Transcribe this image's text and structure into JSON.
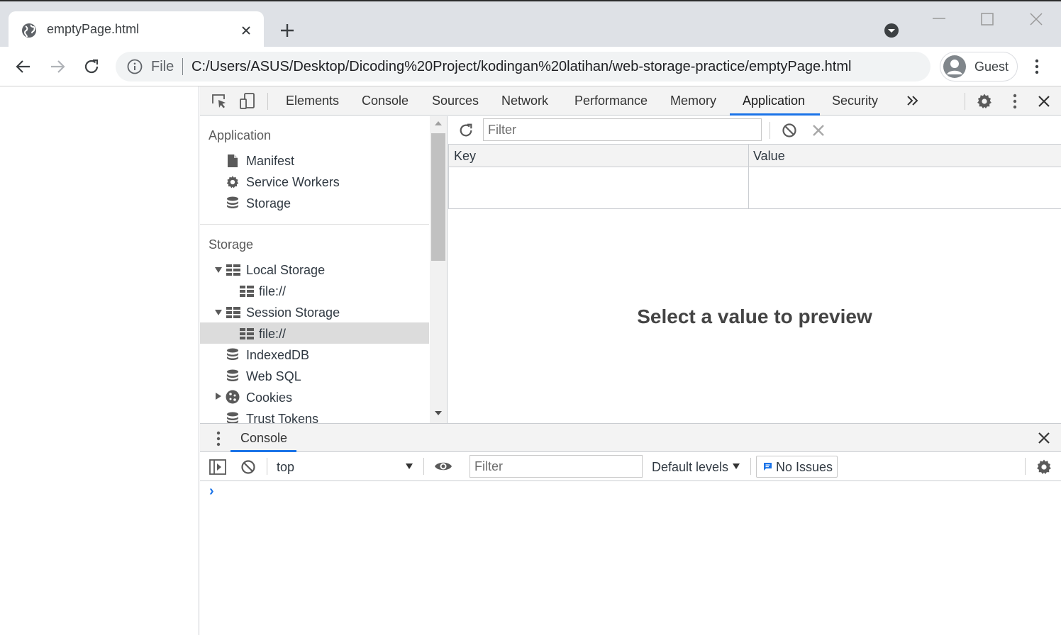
{
  "browser": {
    "tab_title": "emptyPage.html",
    "omnibox": {
      "scheme_label": "File",
      "url": "C:/Users/ASUS/Desktop/Dicoding%20Project/kodingan%20latihan/web-storage-practice/emptyPage.html"
    },
    "profile_label": "Guest"
  },
  "devtools": {
    "tabs": [
      "Elements",
      "Console",
      "Sources",
      "Network",
      "Performance",
      "Memory",
      "Application",
      "Security"
    ],
    "active_tab": "Application",
    "sidebar": {
      "application_section": {
        "title": "Application",
        "items": [
          "Manifest",
          "Service Workers",
          "Storage"
        ]
      },
      "storage_section": {
        "title": "Storage",
        "local_storage": {
          "label": "Local Storage",
          "child": "file://"
        },
        "session_storage": {
          "label": "Session Storage",
          "child": "file://"
        },
        "items": [
          "IndexedDB",
          "Web SQL",
          "Cookies",
          "Trust Tokens"
        ]
      }
    },
    "main": {
      "filter_placeholder": "Filter",
      "columns": [
        "Key",
        "Value"
      ],
      "preview_text": "Select a value to preview"
    },
    "drawer": {
      "tab_label": "Console",
      "context": "top",
      "filter_placeholder": "Filter",
      "levels_label": "Default levels",
      "issues_label": "No Issues",
      "prompt": "›"
    }
  },
  "colors": {
    "accent": "#1a73e8",
    "selected_row": "#dcdcdc"
  }
}
